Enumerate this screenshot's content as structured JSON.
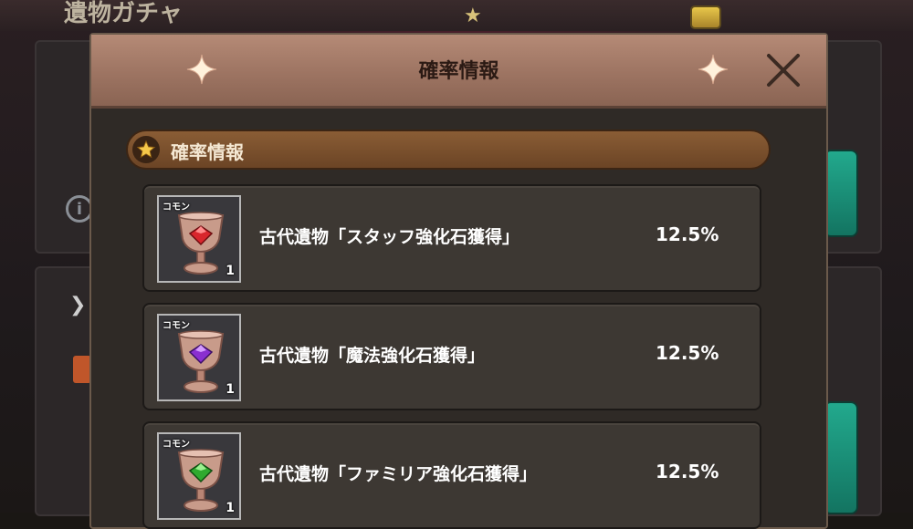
{
  "background": {
    "title_fragment": "遺物ガチャ"
  },
  "modal": {
    "title": "確率情報",
    "section_title": "確率情報",
    "items": [
      {
        "rarity": "コモン",
        "count": "1",
        "name": "古代遺物「スタッフ強化石獲得」",
        "rate": "12.5%",
        "gem_color": "#d8262c",
        "gem_highlight": "#ff8a8a"
      },
      {
        "rarity": "コモン",
        "count": "1",
        "name": "古代遺物「魔法強化石獲得」",
        "rate": "12.5%",
        "gem_color": "#8a2fd0",
        "gem_highlight": "#d39bff"
      },
      {
        "rarity": "コモン",
        "count": "1",
        "name": "古代遺物「ファミリア強化石獲得」",
        "rate": "12.5%",
        "gem_color": "#2faa2f",
        "gem_highlight": "#9bf08f"
      }
    ]
  },
  "icons": {
    "sparkle": "sparkle-icon",
    "close": "close-icon",
    "star": "star-icon",
    "goblet": "goblet-icon",
    "info": "info-icon"
  }
}
